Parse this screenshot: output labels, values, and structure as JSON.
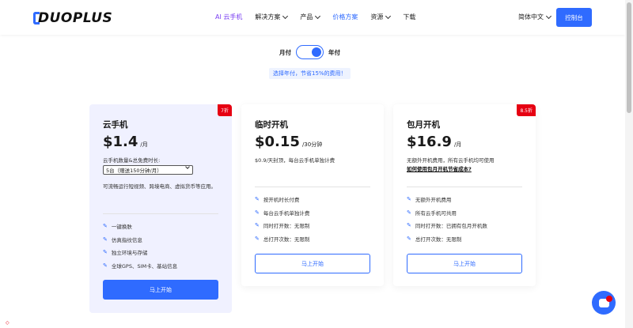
{
  "header": {
    "logo_text": "DUOPLUS",
    "nav": [
      {
        "label": "AI 云手机",
        "has_menu": false,
        "style": "ai"
      },
      {
        "label": "解决方案",
        "has_menu": true,
        "style": ""
      },
      {
        "label": "产品",
        "has_menu": true,
        "style": ""
      },
      {
        "label": "价格方案",
        "has_menu": false,
        "style": "active"
      },
      {
        "label": "资源",
        "has_menu": true,
        "style": ""
      },
      {
        "label": "下载",
        "has_menu": false,
        "style": ""
      }
    ],
    "language": "简体中文",
    "console_button": "控制台"
  },
  "billing": {
    "monthly_label": "月付",
    "yearly_label": "年付",
    "yearly_selected": true,
    "promo": "选择年付，节省15%的费用！"
  },
  "cards": [
    {
      "title": "云手机",
      "price": "$1.4",
      "unit": "/月",
      "badge": "7折",
      "desc": "云手机数量&总免费时长:",
      "select_value": "5台（赠送150分钟/月）",
      "note": "可流畅运行短视频、跨境电商、虚拟货币等应用。",
      "features": [
        "一键换肤",
        "仿真指纹信息",
        "独立环境与存储",
        "全球GPS、SIM卡、基站信息"
      ],
      "button": "马上开始"
    },
    {
      "title": "临时开机",
      "price": "$0.15",
      "unit": "/30分钟",
      "badge": "",
      "desc": "$0.9/天封顶，每台云手机单独计费",
      "features": [
        "按开机时长付费",
        "每台云手机单独计费",
        "同时打开数：无限制",
        "总打开次数：无限制"
      ],
      "button": "马上开始"
    },
    {
      "title": "包月开机",
      "price": "$16.9",
      "unit": "/月",
      "badge": "8.5折",
      "desc": "无额外开机费用，所有云手机均可使用",
      "desc_link": "如何使用包月开机节省成本?",
      "features": [
        "无额外开机费用",
        "所有云手机可共用",
        "同时打开数：已拥有包月开机数",
        "总打开次数：无限制"
      ],
      "button": "马上开始"
    }
  ],
  "colors": {
    "accent": "#2f6bff",
    "badge": "#e60012",
    "ai": "#7a3ff2"
  },
  "icons": {
    "feature_bullet": "pin-icon",
    "chat": "chat-icon"
  }
}
